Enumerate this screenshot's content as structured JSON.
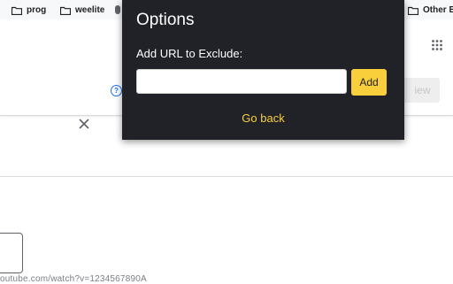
{
  "bookmarks": [
    {
      "label": "prog",
      "icon": "folder-icon"
    },
    {
      "label": "weelite",
      "icon": "folder-icon"
    },
    {
      "label": "Other B",
      "icon": "folder-icon"
    }
  ],
  "page": {
    "view_button_label": "iew",
    "help_icon_glyph": "?",
    "close_icon": "close-icon",
    "url_hint": "outube.com/watch?v=1234567890A"
  },
  "popup": {
    "title": "Options",
    "label": "Add URL to Exclude:",
    "input_value": "",
    "add_label": "Add",
    "go_back_label": "Go back"
  },
  "colors": {
    "popup_bg": "#202228",
    "accent_yellow": "#f9d03b",
    "help_blue": "#1a73e8"
  }
}
